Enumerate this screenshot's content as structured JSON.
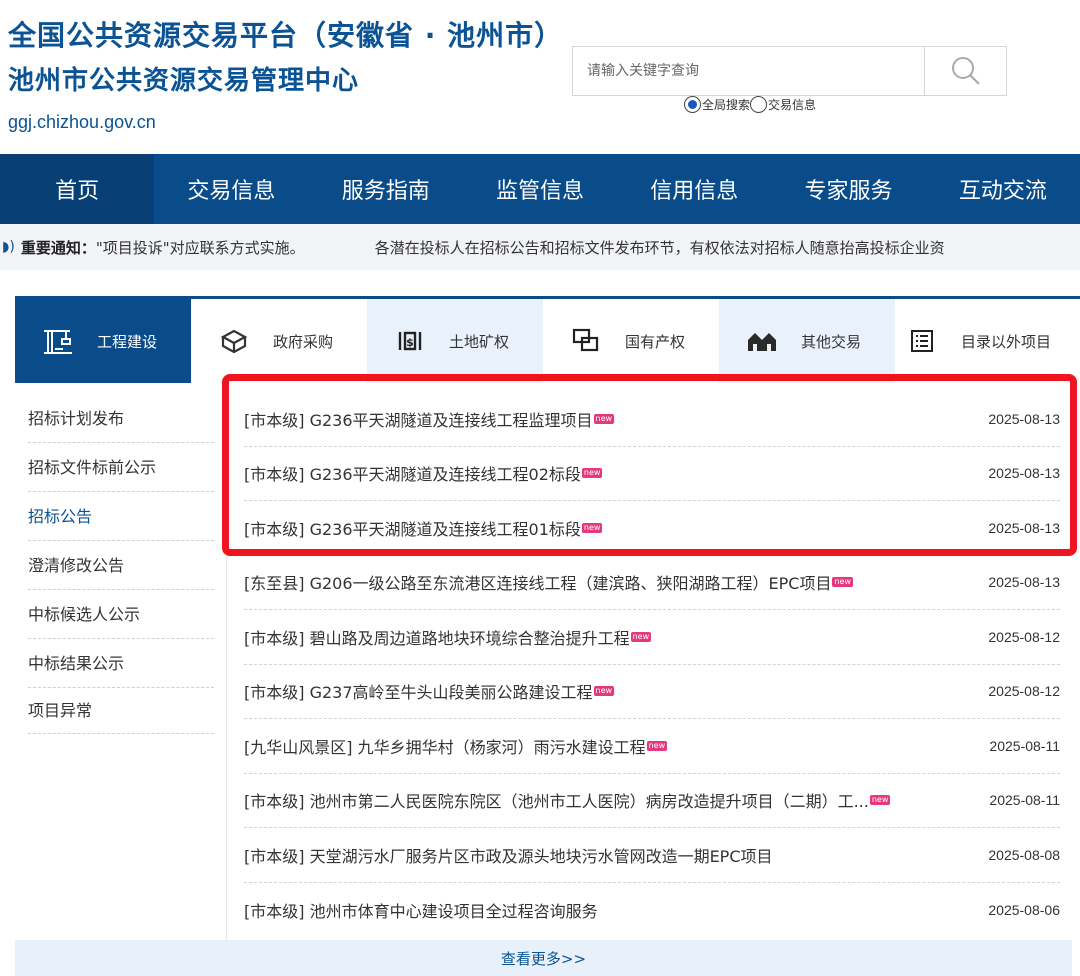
{
  "header": {
    "title_line1": "全国公共资源交易平台（安徽省 · 池州市）",
    "title_line2": "池州市公共资源交易管理中心",
    "domain": "ggj.chizhou.gov.cn",
    "search_placeholder": "请输入关键字查询",
    "radio_global": "全局搜索",
    "radio_trade": "交易信息"
  },
  "nav": [
    "首页",
    "交易信息",
    "服务指南",
    "监管信息",
    "信用信息",
    "专家服务",
    "互动交流"
  ],
  "notice": {
    "label": "重要通知：",
    "item1": "\"项目投诉\"对应联系方式实施。",
    "item2": "各潜在投标人在招标公告和招标文件发布环节，有权依法对招标人随意抬高投标企业资"
  },
  "tabs": [
    "工程建设",
    "政府采购",
    "土地矿权",
    "国有产权",
    "其他交易",
    "目录以外项目"
  ],
  "sidemenu": [
    "招标计划发布",
    "招标文件标前公示",
    "招标公告",
    "澄清修改公告",
    "中标候选人公示",
    "中标结果公示",
    "项目异常"
  ],
  "list": [
    {
      "title": "[市本级] G236平天湖隧道及连接线工程监理项目",
      "date": "2025-08-13",
      "new": "new"
    },
    {
      "title": "[市本级] G236平天湖隧道及连接线工程02标段",
      "date": "2025-08-13",
      "new": "new"
    },
    {
      "title": "[市本级] G236平天湖隧道及连接线工程01标段",
      "date": "2025-08-13",
      "new": "new"
    },
    {
      "title": "[东至县] G206一级公路至东流港区连接线工程（建滨路、狭阳湖路工程）EPC项目",
      "date": "2025-08-13",
      "new": "new"
    },
    {
      "title": "[市本级] 碧山路及周边道路地块环境综合整治提升工程",
      "date": "2025-08-12",
      "new": "new"
    },
    {
      "title": "[市本级] G237高岭至牛头山段美丽公路建设工程",
      "date": "2025-08-12",
      "new": "new"
    },
    {
      "title": "[九华山风景区] 九华乡拥华村（杨家河）雨污水建设工程",
      "date": "2025-08-11",
      "new": "new"
    },
    {
      "title": "[市本级] 池州市第二人民医院东院区（池州市工人医院）病房改造提升项目（二期）工...",
      "date": "2025-08-11",
      "new": "new"
    },
    {
      "title": "[市本级] 天堂湖污水厂服务片区市政及源头地块污水管网改造一期EPC项目",
      "date": "2025-08-08",
      "new": ""
    },
    {
      "title": "[市本级] 池州市体育中心建设项目全过程咨询服务",
      "date": "2025-08-06",
      "new": ""
    }
  ],
  "more": "查看更多>>",
  "colors": {
    "primary": "#0a4c8a",
    "highlight": "#f0141e",
    "new_badge": "#e5387d"
  }
}
